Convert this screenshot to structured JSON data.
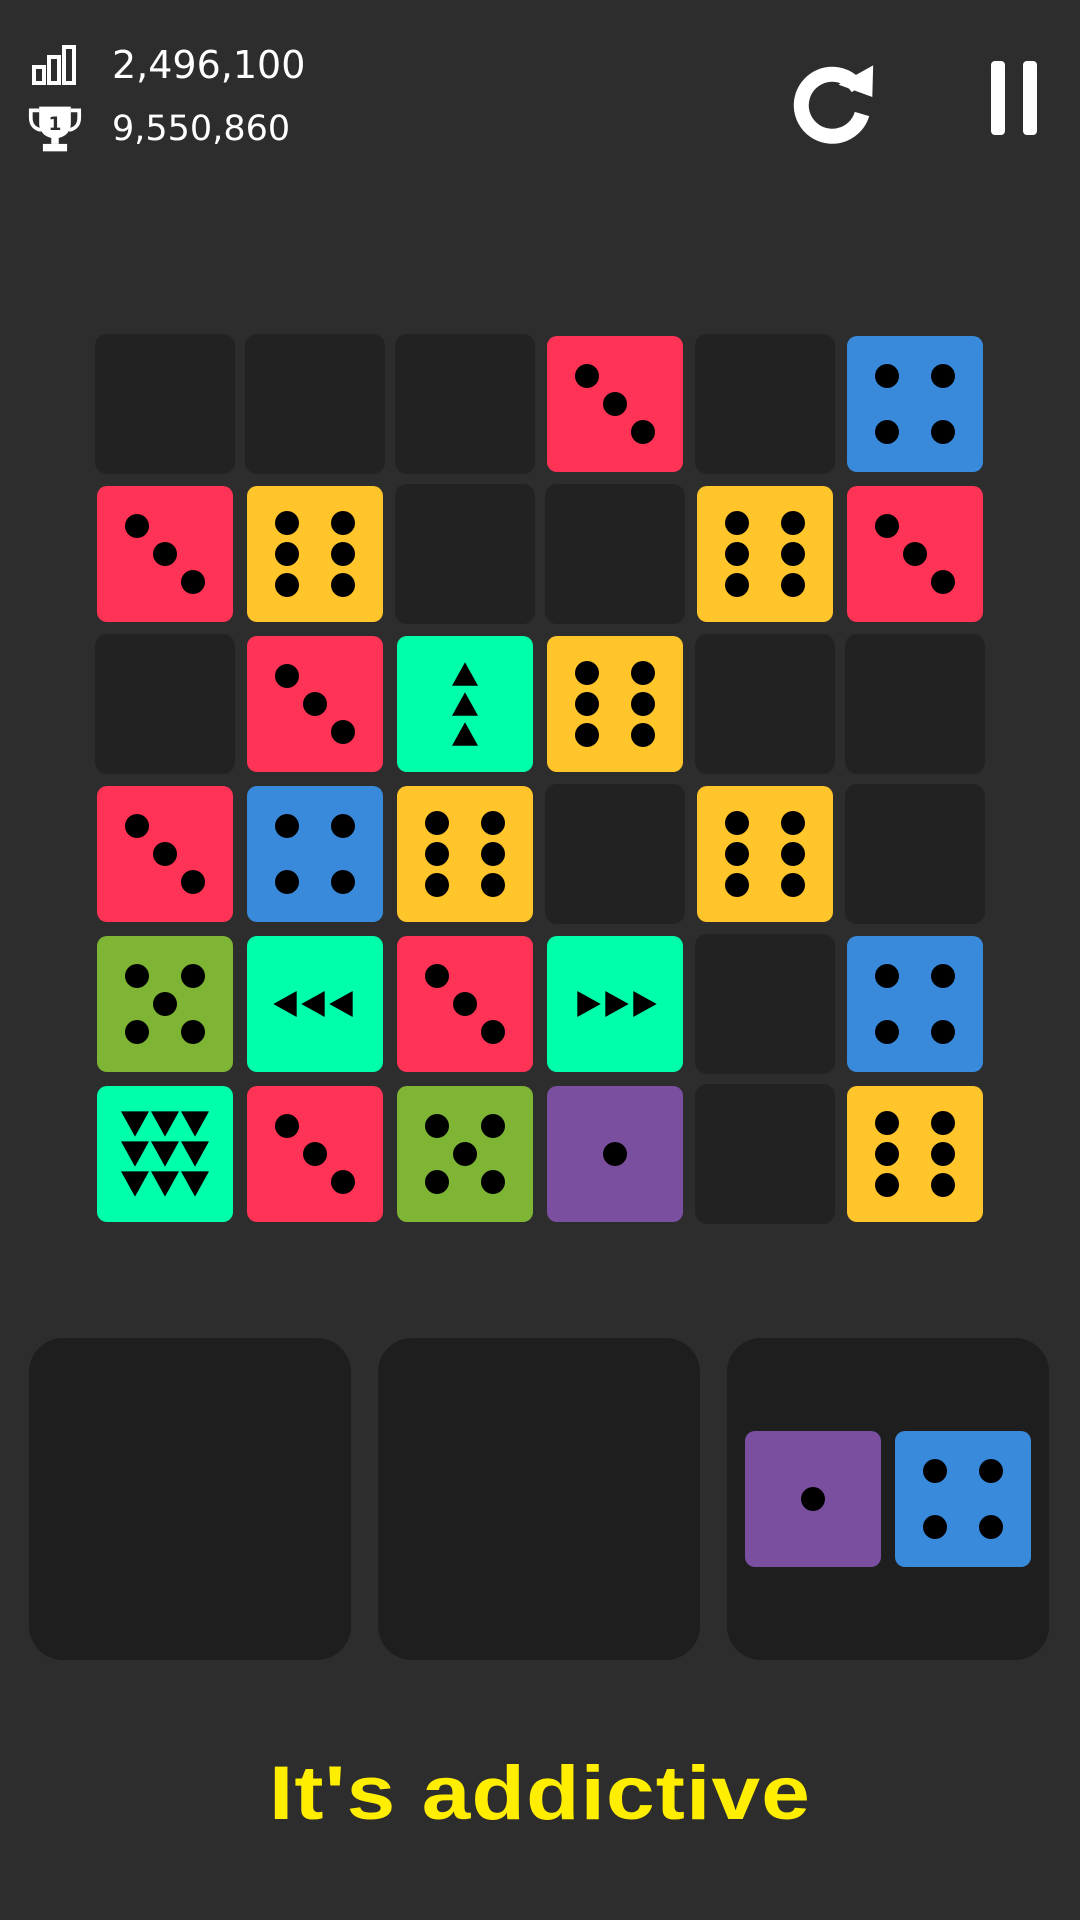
{
  "hud": {
    "score": "2,496,100",
    "best": "9,550,860",
    "score_icon": "signal-bars-icon",
    "best_icon": "trophy-icon",
    "trophy_rank": "1",
    "restart_icon": "restart-icon",
    "pause_icon": "pause-icon"
  },
  "colors": {
    "background": "#2d2d2d",
    "empty_cell": "#222222",
    "tray": "#1e1e1e",
    "red": "#ff3355",
    "yellow": "#ffc52a",
    "blue": "#3a8adb",
    "green": "#7fb534",
    "aqua": "#00ffaa",
    "purple": "#7b4fa0",
    "tagline": "#ffee00"
  },
  "board": {
    "rows": 6,
    "cols": 6,
    "grid": [
      [
        null,
        null,
        null,
        {
          "color": "red",
          "face": 3
        },
        null,
        {
          "color": "blue",
          "face": 4
        }
      ],
      [
        {
          "color": "red",
          "face": 3
        },
        {
          "color": "yellow",
          "face": 6
        },
        null,
        null,
        {
          "color": "yellow",
          "face": 6
        },
        {
          "color": "red",
          "face": 3
        }
      ],
      [
        null,
        {
          "color": "red",
          "face": 3
        },
        {
          "color": "aqua",
          "face": "arrows-up"
        },
        {
          "color": "yellow",
          "face": 6
        },
        null,
        null
      ],
      [
        {
          "color": "red",
          "face": 3
        },
        {
          "color": "blue",
          "face": 4
        },
        {
          "color": "yellow",
          "face": 6
        },
        null,
        {
          "color": "yellow",
          "face": 6
        },
        null
      ],
      [
        {
          "color": "green",
          "face": 5
        },
        {
          "color": "aqua",
          "face": "arrows-left"
        },
        {
          "color": "red",
          "face": 3
        },
        {
          "color": "aqua",
          "face": "arrows-right"
        },
        null,
        {
          "color": "blue",
          "face": 4
        }
      ],
      [
        {
          "color": "aqua",
          "face": "arrows-down"
        },
        {
          "color": "red",
          "face": 3
        },
        {
          "color": "green",
          "face": 5
        },
        {
          "color": "purple",
          "face": 1
        },
        null,
        {
          "color": "yellow",
          "face": 6
        }
      ]
    ]
  },
  "trays": [
    {
      "pieces": []
    },
    {
      "pieces": []
    },
    {
      "pieces": [
        {
          "color": "purple",
          "face": 1
        },
        {
          "color": "blue",
          "face": 4
        }
      ]
    }
  ],
  "tagline": "It's addictive"
}
